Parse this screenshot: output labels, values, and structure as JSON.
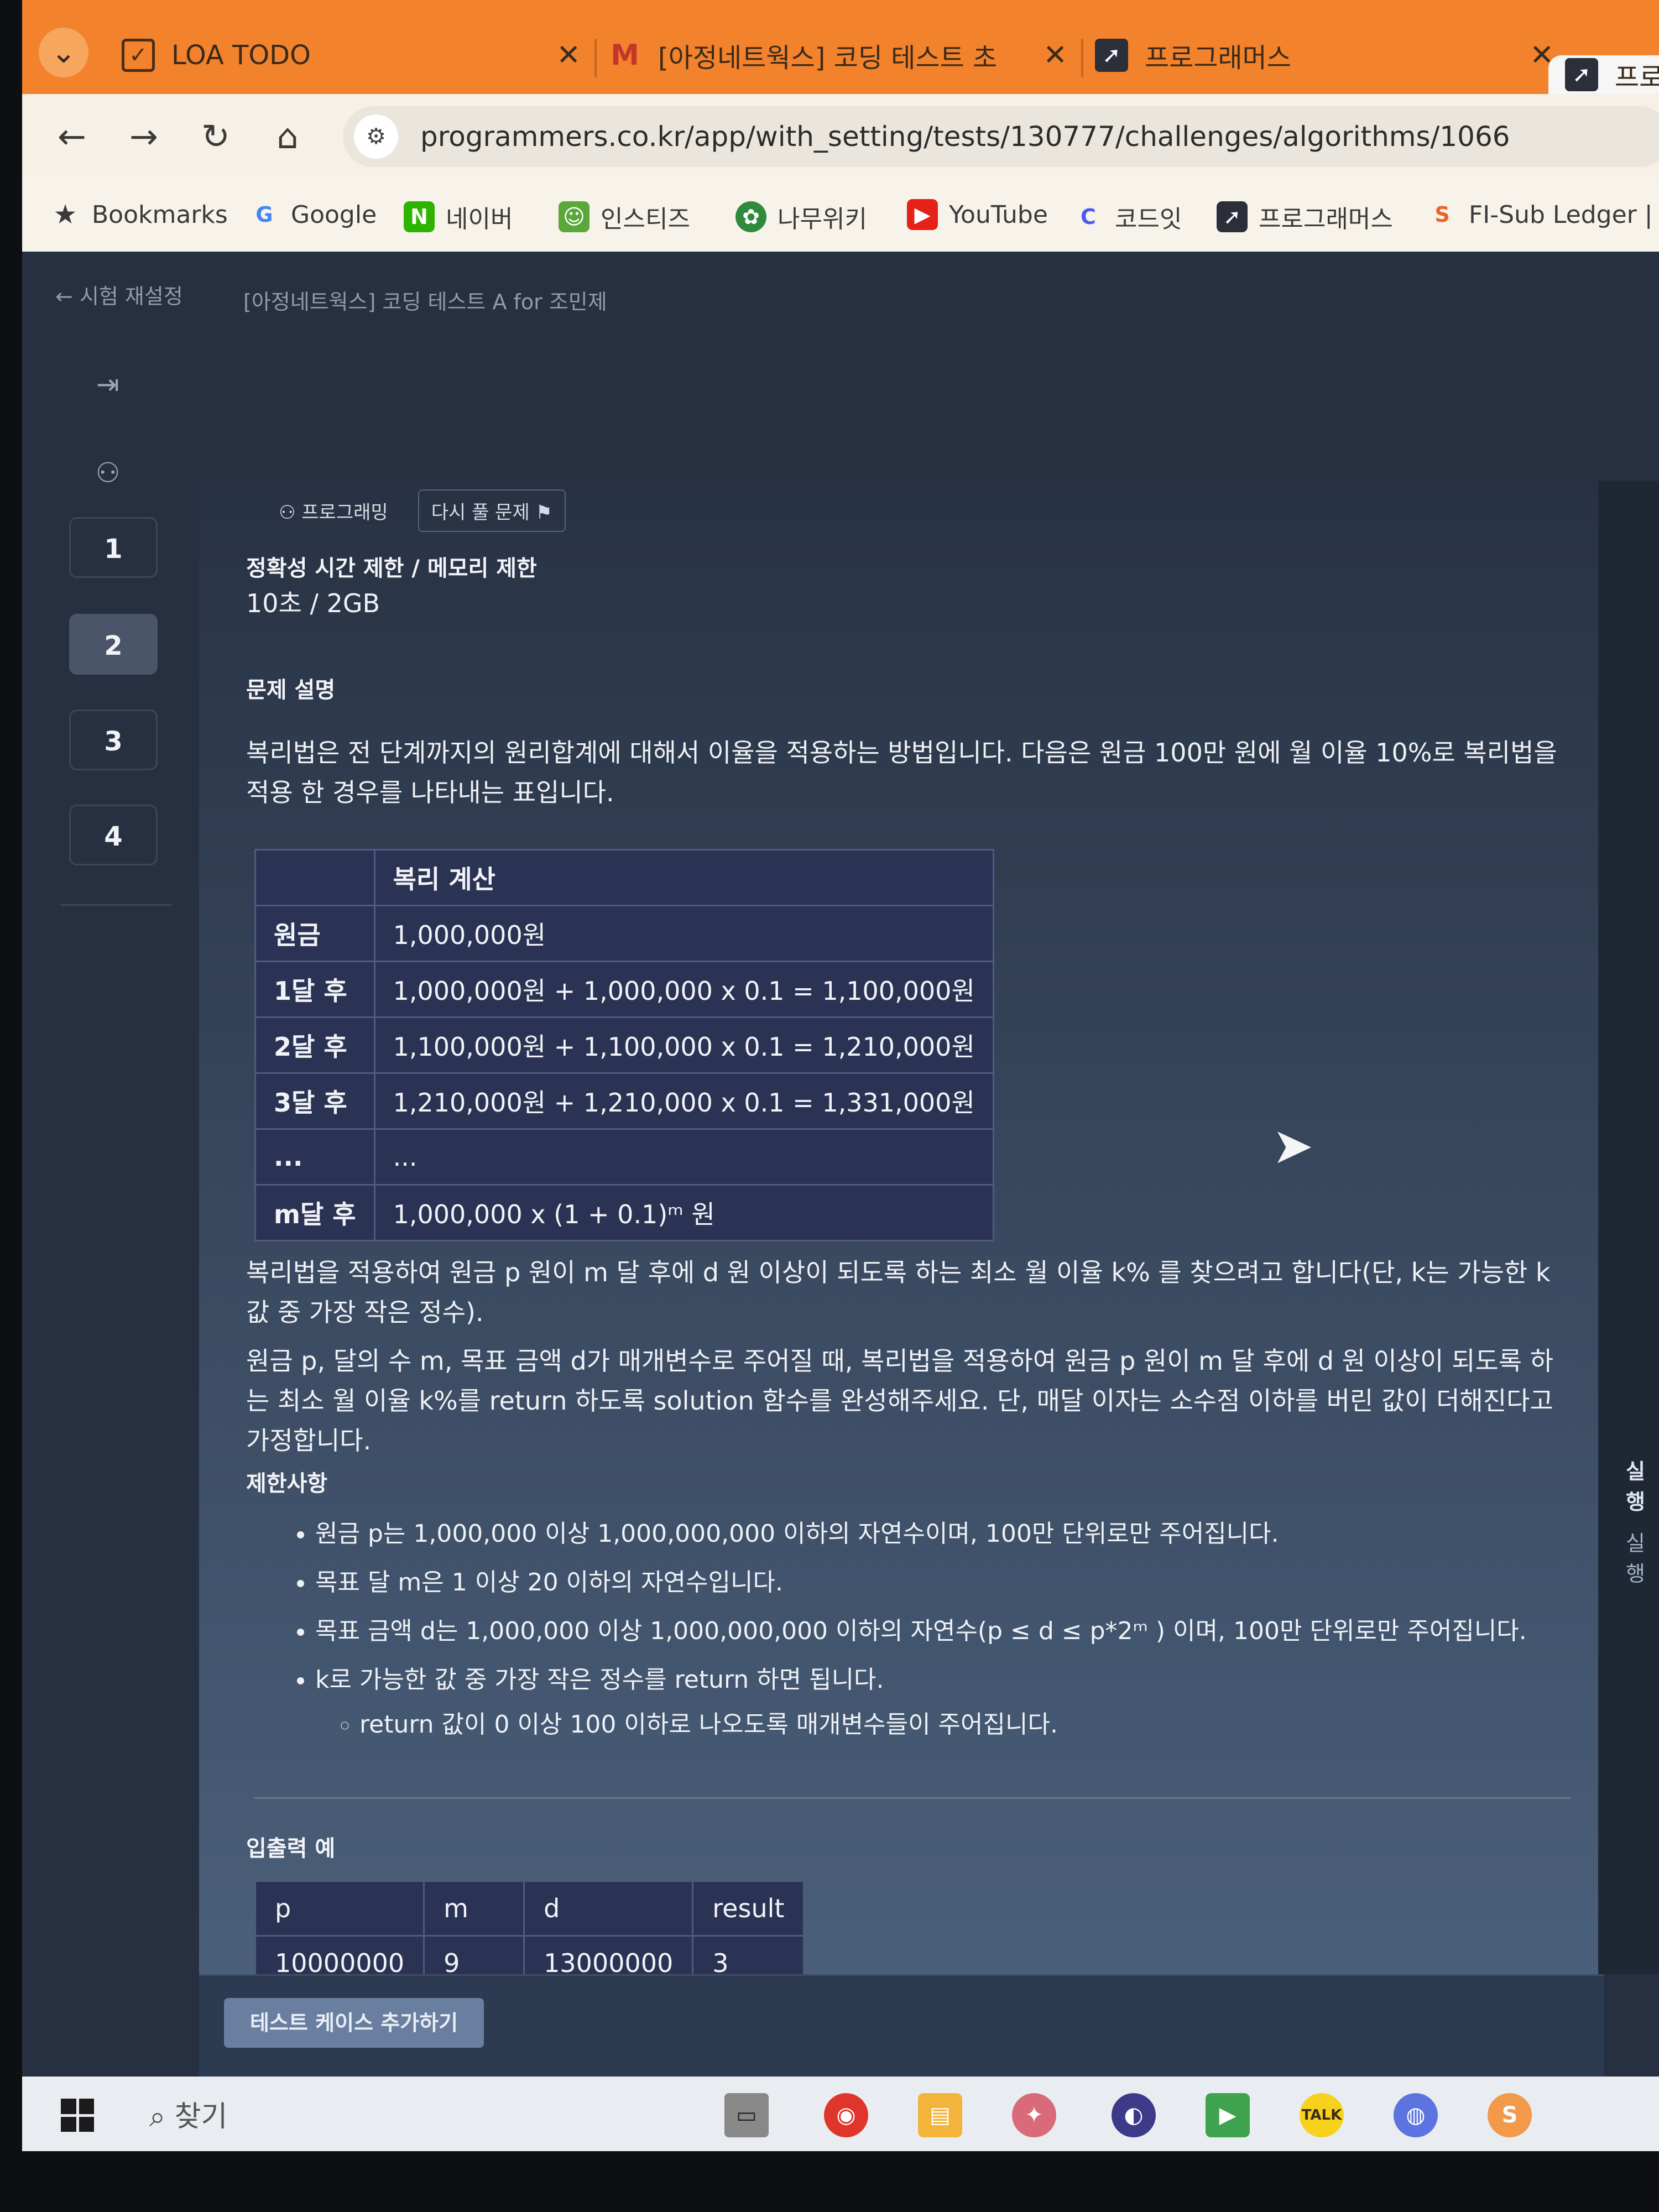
{
  "browser": {
    "tabs": [
      {
        "title": "LOA TODO",
        "icon": "checkbox-icon"
      },
      {
        "title": "[아정네트웍스] 코딩 테스트 초",
        "icon": "gmail-icon"
      },
      {
        "title": "프로그래머스",
        "icon": "programmers-icon"
      },
      {
        "title": "프로",
        "icon": "programmers-icon"
      }
    ],
    "url": "programmers.co.kr/app/with_setting/tests/130777/challenges/algorithms/1066",
    "bookmarks": [
      {
        "label": "Bookmarks",
        "icon": "star-icon"
      },
      {
        "label": "Google",
        "icon": "google-icon",
        "glyph": "G"
      },
      {
        "label": "네이버",
        "icon": "naver-icon",
        "glyph": "N"
      },
      {
        "label": "인스티즈",
        "icon": "instiz-icon",
        "glyph": "☺"
      },
      {
        "label": "나무위키",
        "icon": "namuwiki-icon",
        "glyph": "✿"
      },
      {
        "label": "YouTube",
        "icon": "youtube-icon",
        "glyph": "▶"
      },
      {
        "label": "코드잇",
        "icon": "codeit-icon",
        "glyph": "C"
      },
      {
        "label": "프로그래머스",
        "icon": "programmers-icon",
        "glyph": "➚"
      },
      {
        "label": "FI-Sub Ledger | L",
        "icon": "fi-sub-icon",
        "glyph": "S"
      }
    ]
  },
  "header": {
    "back_label": "시험 재설정",
    "exam_title": "[아정네트웍스] 코딩 테스트 A for 조민제"
  },
  "sidebar": {
    "questions": [
      "1",
      "2",
      "3",
      "4"
    ],
    "active_question": "2"
  },
  "problem": {
    "category_chip": "프로그래밍",
    "retry_chip": "다시 풀 문제",
    "limits_heading": "정확성 시간 제한 / 메모리 제한",
    "limits_value": "10초 / 2GB",
    "description_heading": "문제 설명",
    "description_p1": "복리법은 전 단계까지의 원리합계에 대해서 이율을 적용하는 방법입니다. 다음은 원금 100만 원에 월 이율 10%로 복리법을 적용 한 경우를 나타내는 표입니다.",
    "compound_table": {
      "header": [
        "",
        "복리 계산"
      ],
      "rows": [
        [
          "원금",
          "1,000,000원"
        ],
        [
          "1달 후",
          "1,000,000원 + 1,000,000 x 0.1 = 1,100,000원"
        ],
        [
          "2달 후",
          "1,100,000원 + 1,100,000 x 0.1 = 1,210,000원"
        ],
        [
          "3달 후",
          "1,210,000원 + 1,210,000 x 0.1 = 1,331,000원"
        ],
        [
          "...",
          "..."
        ],
        [
          "m달 후",
          "1,000,000 x (1 + 0.1)ᵐ 원"
        ]
      ]
    },
    "description_p2": "복리법을 적용하여 원금 p 원이 m 달 후에 d 원 이상이 되도록 하는 최소 월 이율 k% 를 찾으려고 합니다(단, k는 가능한 k 값 중 가장 작은 정수).",
    "description_p3": "원금 p, 달의 수 m, 목표 금액 d가 매개변수로 주어질 때, 복리법을 적용하여 원금 p 원이 m 달 후에 d 원 이상이 되도록 하는 최소 월 이율 k%를 return 하도록 solution 함수를 완성해주세요. 단, 매달 이자는 소수점 이하를 버린 값이 더해진다고 가정합니다.",
    "constraints_heading": "제한사항",
    "constraints": [
      "원금 p는 1,000,000 이상 1,000,000,000 이하의 자연수이며, 100만 단위로만 주어집니다.",
      "목표 달 m은 1 이상 20 이하의 자연수입니다.",
      "목표 금액 d는 1,000,000 이상 1,000,000,000 이하의 자연수(p ≤ d ≤ p*2ᵐ ) 이며, 100만 단위로만 주어집니다.",
      "k로 가능한 값 중 가장 작은 정수를 return 하면 됩니다."
    ],
    "sub_constraint": "return 값이 0 이상 100 이하로 나오도록 매개변수들이 주어집니다.",
    "io_heading": "입출력 예",
    "io_table": {
      "header": [
        "p",
        "m",
        "d",
        "result"
      ],
      "rows": [
        [
          "10000000",
          "9",
          "13000000",
          "3"
        ]
      ]
    }
  },
  "bottom": {
    "add_testcase_label": "테스트 케이스 추가하기"
  },
  "right_rail": {
    "run_label_1": "실행",
    "run_label_2": "실행"
  },
  "taskbar": {
    "search_label": "찾기"
  }
}
